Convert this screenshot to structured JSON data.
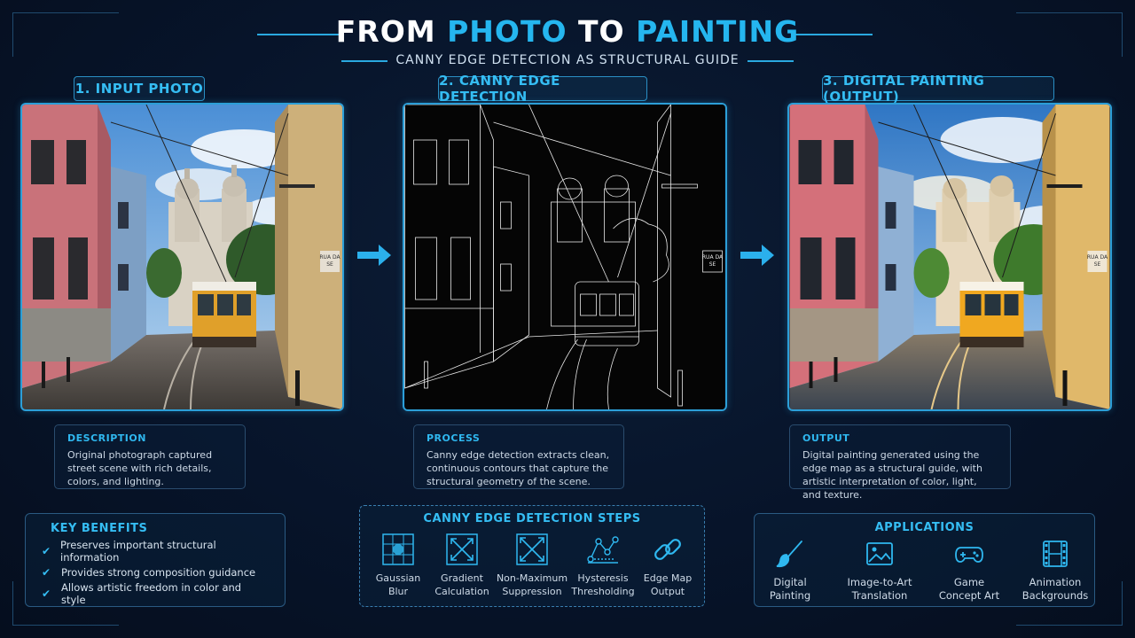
{
  "header": {
    "title_from": "FROM",
    "title_photo": "PHOTO",
    "title_to": "TO",
    "title_painting": "PAINTING",
    "subtitle": "CANNY EDGE DETECTION AS STRUCTURAL GUIDE"
  },
  "steps": [
    {
      "label": "1. INPUT PHOTO"
    },
    {
      "label": "2. CANNY EDGE DETECTION"
    },
    {
      "label": "3. DIGITAL PAINTING (OUTPUT)"
    }
  ],
  "descriptions": [
    {
      "heading": "DESCRIPTION",
      "text": "Original photograph captured street scene with rich details, colors, and lighting."
    },
    {
      "heading": "PROCESS",
      "text": "Canny edge detection extracts clean, continuous contours that capture the structural geometry of the scene."
    },
    {
      "heading": "OUTPUT",
      "text": "Digital painting generated using the edge map as a structural guide, with artistic interpretation of color, light, and texture."
    }
  ],
  "image_text": {
    "street_sign": "RUA DA SE"
  },
  "benefits": {
    "title": "KEY BENEFITS",
    "items": [
      "Preserves important structural information",
      "Provides strong composition guidance",
      "Allows artistic freedom in color and style"
    ]
  },
  "canny_steps": {
    "title": "CANNY EDGE DETECTION STEPS",
    "items": [
      {
        "line1": "Gaussian",
        "line2": "Blur",
        "icon": "gaussian-blur-icon"
      },
      {
        "line1": "Gradient",
        "line2": "Calculation",
        "icon": "gradient-icon"
      },
      {
        "line1": "Non-Maximum",
        "line2": "Suppression",
        "icon": "suppression-icon"
      },
      {
        "line1": "Hysteresis",
        "line2": "Thresholding",
        "icon": "hysteresis-icon"
      },
      {
        "line1": "Edge Map",
        "line2": "Output",
        "icon": "edge-map-link-icon"
      }
    ]
  },
  "applications": {
    "title": "APPLICATIONS",
    "items": [
      {
        "line1": "Digital",
        "line2": "Painting",
        "icon": "paintbrush-icon"
      },
      {
        "line1": "Image-to-Art",
        "line2": "Translation",
        "icon": "image-icon"
      },
      {
        "line1": "Game",
        "line2": "Concept Art",
        "icon": "gamepad-icon"
      },
      {
        "line1": "Animation",
        "line2": "Backgrounds",
        "icon": "film-icon"
      }
    ]
  },
  "colors": {
    "accent": "#2fb8f0",
    "background": "#07142a",
    "border": "#2a5a82"
  }
}
